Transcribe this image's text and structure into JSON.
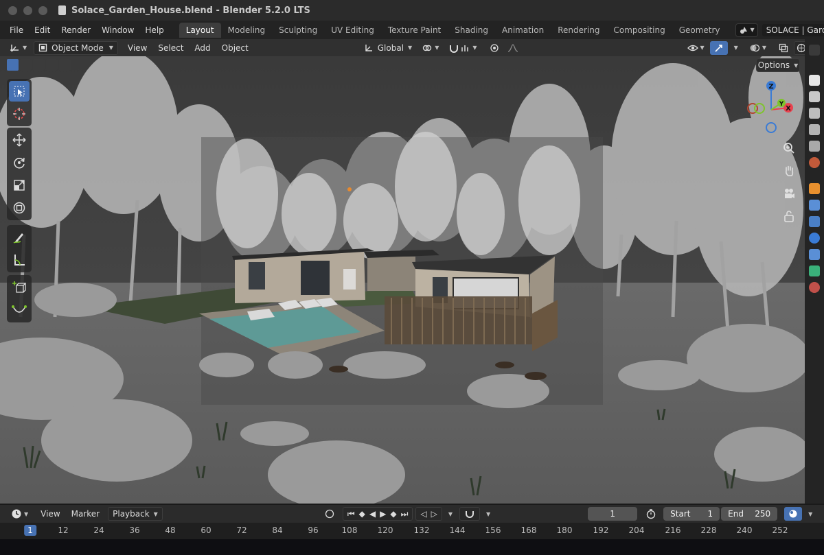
{
  "window": {
    "title": "Solace_Garden_House.blend - Blender 5.2.0 LTS"
  },
  "menubar": {
    "menus": [
      "File",
      "Edit",
      "Render",
      "Window",
      "Help"
    ],
    "workspaces": [
      "Layout",
      "Modeling",
      "Sculpting",
      "UV Editing",
      "Texture Paint",
      "Shading",
      "Animation",
      "Rendering",
      "Compositing",
      "Geometry"
    ],
    "active_workspace": "Layout",
    "scene_name": "SOLACE | Garden House — Architectural Stud"
  },
  "viewport_header": {
    "mode": "Object Mode",
    "menus": [
      "View",
      "Select",
      "Add",
      "Object"
    ],
    "transform_orientation": "Global"
  },
  "viewport": {
    "options_label": "Options",
    "gizmo": {
      "x_label": "X",
      "y_label": "Y",
      "z_label": "Z"
    },
    "colors": {
      "x_axis": "#e8424f",
      "y_axis": "#7ec42c",
      "z_axis": "#3a7bd5",
      "accent": "#4772b3"
    }
  },
  "toolbar": {
    "tools": [
      "select-box-icon",
      "cursor-icon",
      "move-icon",
      "rotate-icon",
      "scale-icon",
      "transform-icon",
      "annotate-icon",
      "measure-icon",
      "add-cube-icon",
      "curve-icon"
    ]
  },
  "timeline": {
    "menus": [
      "View",
      "Marker",
      "Playback"
    ],
    "current_frame": "1",
    "start_label": "Start",
    "start_value": "1",
    "end_label": "End",
    "end_value": "250",
    "ruler": [
      "1",
      "12",
      "24",
      "36",
      "48",
      "60",
      "72",
      "84",
      "96",
      "108",
      "120",
      "132",
      "144",
      "156",
      "168",
      "180",
      "192",
      "204",
      "216",
      "228",
      "240",
      "252"
    ]
  }
}
